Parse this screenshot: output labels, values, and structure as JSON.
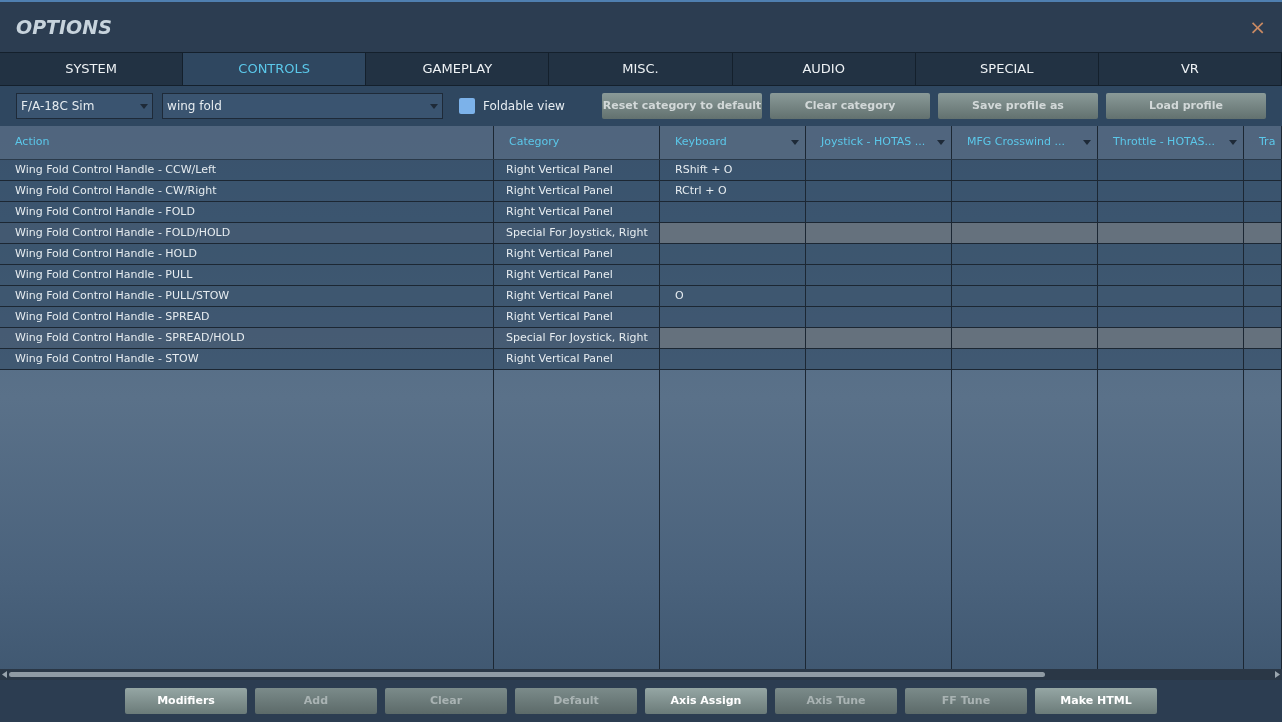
{
  "window": {
    "title": "OPTIONS",
    "close": "×"
  },
  "tabs": [
    {
      "label": "SYSTEM",
      "selected": false
    },
    {
      "label": "CONTROLS",
      "selected": true
    },
    {
      "label": "GAMEPLAY",
      "selected": false
    },
    {
      "label": "MISC.",
      "selected": false
    },
    {
      "label": "AUDIO",
      "selected": false
    },
    {
      "label": "SPECIAL",
      "selected": false
    },
    {
      "label": "VR",
      "selected": false
    }
  ],
  "toolbar": {
    "aircraft": "F/A-18C Sim",
    "category_filter": "wing fold",
    "foldable_view": {
      "label": "Foldable view",
      "checked": false
    },
    "buttons": [
      "Reset category to default",
      "Clear category",
      "Save profile as",
      "Load profile"
    ]
  },
  "table": {
    "columns": [
      {
        "label": "Action",
        "menu": false
      },
      {
        "label": "Category",
        "menu": false
      },
      {
        "label": "Keyboard",
        "menu": true
      },
      {
        "label": "Joystick - HOTAS ...",
        "menu": true
      },
      {
        "label": "MFG Crosswind ...",
        "menu": true
      },
      {
        "label": "Throttle - HOTAS...",
        "menu": true
      },
      {
        "label": "Tra",
        "menu": false
      }
    ],
    "rows": [
      {
        "action": "Wing Fold Control Handle - CCW/Left",
        "category": "Right Vertical Panel",
        "keyboard": "RShift + O",
        "disabled": false
      },
      {
        "action": "Wing Fold Control Handle - CW/Right",
        "category": "Right Vertical Panel",
        "keyboard": "RCtrl + O",
        "disabled": false
      },
      {
        "action": "Wing Fold Control Handle - FOLD",
        "category": "Right Vertical Panel",
        "keyboard": "",
        "disabled": false
      },
      {
        "action": "Wing Fold Control Handle - FOLD/HOLD",
        "category": "Special For Joystick, Right",
        "keyboard": "",
        "disabled": true
      },
      {
        "action": "Wing Fold Control Handle - HOLD",
        "category": "Right Vertical Panel",
        "keyboard": "",
        "disabled": false
      },
      {
        "action": "Wing Fold Control Handle - PULL",
        "category": "Right Vertical Panel",
        "keyboard": "",
        "disabled": false
      },
      {
        "action": "Wing Fold Control Handle - PULL/STOW",
        "category": "Right Vertical Panel",
        "keyboard": "O",
        "disabled": false
      },
      {
        "action": "Wing Fold Control Handle - SPREAD",
        "category": "Right Vertical Panel",
        "keyboard": "",
        "disabled": false
      },
      {
        "action": "Wing Fold Control Handle - SPREAD/HOLD",
        "category": "Special For Joystick, Right",
        "keyboard": "",
        "disabled": true
      },
      {
        "action": "Wing Fold Control Handle - STOW",
        "category": "Right Vertical Panel",
        "keyboard": "",
        "disabled": false
      }
    ]
  },
  "bottom_buttons": [
    {
      "label": "Modifiers",
      "disabled": false
    },
    {
      "label": "Add",
      "disabled": true
    },
    {
      "label": "Clear",
      "disabled": true
    },
    {
      "label": "Default",
      "disabled": true
    },
    {
      "label": "Axis Assign",
      "disabled": false
    },
    {
      "label": "Axis Tune",
      "disabled": true
    },
    {
      "label": "FF Tune",
      "disabled": true
    },
    {
      "label": "Make HTML",
      "disabled": false
    }
  ]
}
